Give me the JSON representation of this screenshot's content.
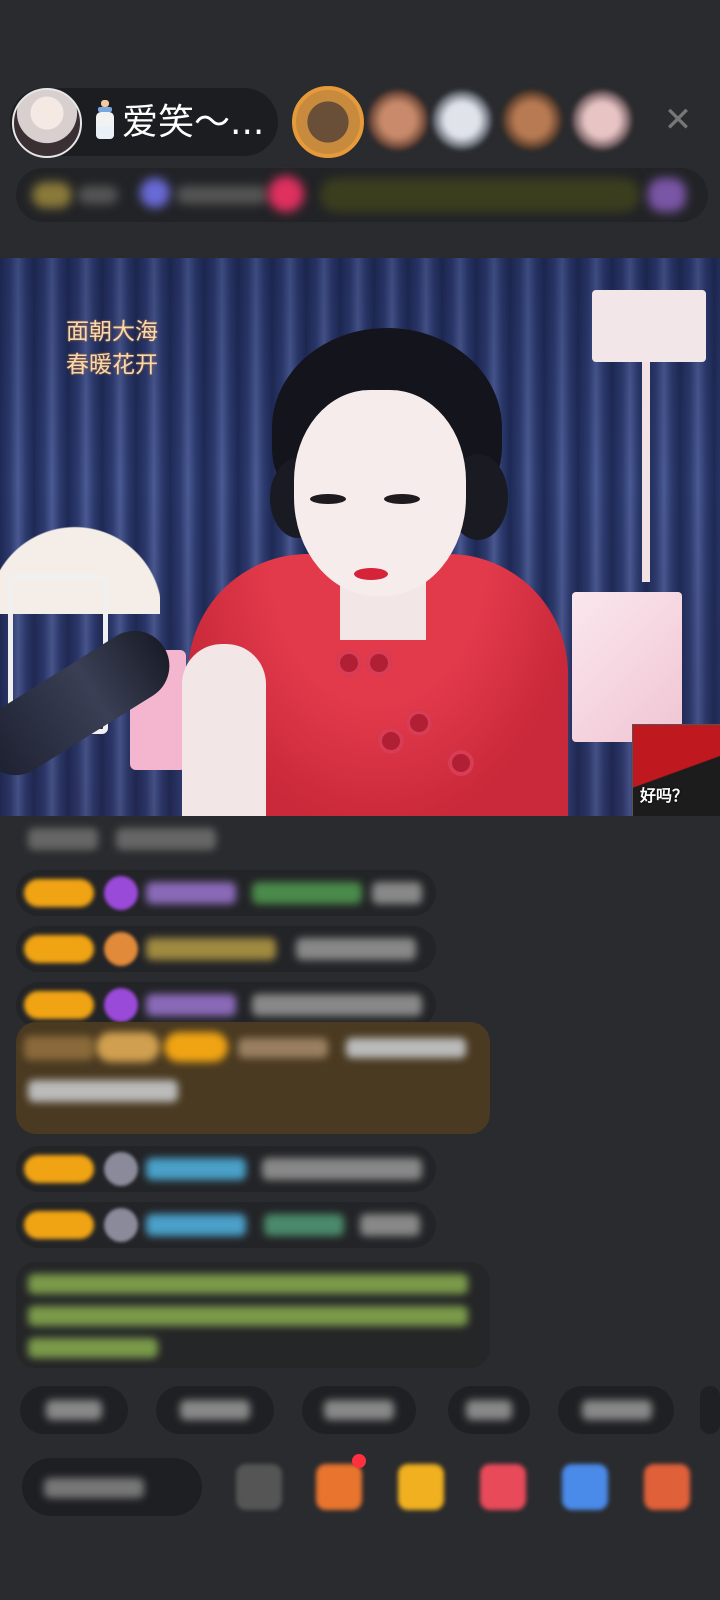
{
  "header": {
    "host_name": "爱笑～...",
    "close_icon": "close-icon"
  },
  "video": {
    "overlay_slogan_line1": "面朝大海",
    "overlay_slogan_line2": "春暖花开",
    "sticker_caption": "好吗？"
  },
  "colors": {
    "background": "#2a2b2e",
    "badge": "#f0a414",
    "system_message": "#4a3a21"
  }
}
